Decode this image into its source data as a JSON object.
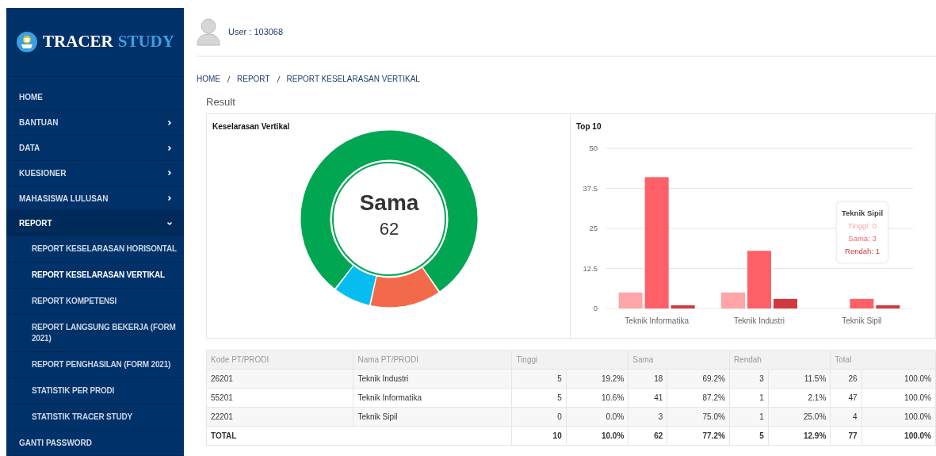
{
  "sidebar": {
    "logo_text": "TRACER",
    "logo_text_accent": "STUDY",
    "items": [
      {
        "label": "HOME",
        "kind": "link"
      },
      {
        "label": "BANTUAN",
        "kind": "menu",
        "expanded": false
      },
      {
        "label": "DATA",
        "kind": "menu",
        "expanded": false
      },
      {
        "label": "KUESIONER",
        "kind": "menu",
        "expanded": false
      },
      {
        "label": "MAHASISWA LULUSAN",
        "kind": "menu",
        "expanded": false
      },
      {
        "label": "REPORT",
        "kind": "menu",
        "expanded": true,
        "children": [
          {
            "label": "REPORT KESELARASAN HORISONTAL",
            "selected": false
          },
          {
            "label": "REPORT KESELARASAN VERTIKAL",
            "selected": true
          },
          {
            "label": "REPORT KOMPETENSI",
            "selected": false
          },
          {
            "label": "REPORT LANGSUNG BEKERJA (FORM 2021)",
            "selected": false
          },
          {
            "label": "REPORT PENGHASILAN (FORM 2021)",
            "selected": false
          },
          {
            "label": "STATISTIK PER PRODI",
            "selected": false
          },
          {
            "label": "STATISTIK TRACER STUDY",
            "selected": false
          }
        ]
      },
      {
        "label": "GANTI PASSWORD",
        "kind": "link"
      }
    ]
  },
  "header": {
    "user": "User : 103068"
  },
  "breadcrumb": [
    "HOME",
    "REPORT",
    "REPORT KESELARASAN VERTIKAL"
  ],
  "result": {
    "title": "Result",
    "donut": {
      "title": "Keselarasan Vertikal",
      "center_label": "Sama",
      "center_value": "62"
    },
    "bar": {
      "title": "Top 10",
      "chart_data": {
        "type": "bar",
        "categories": [
          "Teknik Informatika",
          "Teknik Industri",
          "Teknik Sipil"
        ],
        "series": [
          {
            "color": "#ffa5a8",
            "values": [
              5,
              5,
              0
            ]
          },
          {
            "color": "#ff6068",
            "values": [
              41,
              18,
              3
            ]
          },
          {
            "color": "#d0393f",
            "values": [
              1,
              3,
              1
            ]
          }
        ],
        "ylim": [
          0,
          50
        ],
        "yticks": [
          0,
          12.5,
          25,
          37.5,
          50
        ],
        "grid": true
      },
      "tooltip": {
        "title": "Teknik Sipil",
        "lines": [
          "Tinggi: 0",
          "Sama: 3",
          "Rendah: 1"
        ]
      }
    }
  },
  "table": {
    "columns": [
      {
        "label": "Kode PT/PRODI"
      },
      {
        "label": "Nama PT/PRODI"
      },
      {
        "label": "Tinggi",
        "colspan": 2
      },
      {
        "label": "Sama",
        "colspan": 2
      },
      {
        "label": "Rendah",
        "colspan": 2
      },
      {
        "label": "Total",
        "colspan": 2
      }
    ],
    "rows": [
      [
        "26201",
        "Teknik Industri",
        "5",
        "19.2%",
        "18",
        "69.2%",
        "3",
        "11.5%",
        "26",
        "100.0%"
      ],
      [
        "55201",
        "Teknik Informatika",
        "5",
        "10.6%",
        "41",
        "87.2%",
        "1",
        "2.1%",
        "47",
        "100.0%"
      ],
      [
        "22201",
        "Teknik Sipil",
        "0",
        "0.0%",
        "3",
        "75.0%",
        "1",
        "25.0%",
        "4",
        "100.0%"
      ]
    ],
    "total": [
      "TOTAL",
      "10",
      "10.0%",
      "62",
      "77.2%",
      "5",
      "12.9%",
      "77",
      "100.0%"
    ]
  }
}
